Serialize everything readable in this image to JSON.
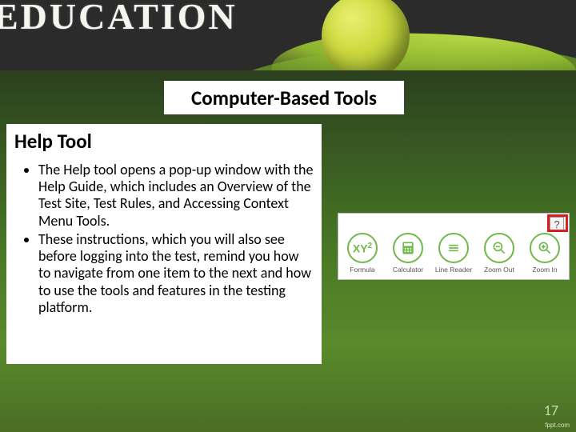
{
  "banner": {
    "chalk_word": "EDUCATION"
  },
  "title": "Computer-Based Tools",
  "subheading": "Help Tool",
  "bullets": [
    "The Help tool opens a pop-up window with the Help Guide, which includes an Overview of the Test Site, Test Rules, and Accessing Context Menu Tools.",
    "These instructions, which you will also see before logging into the test, remind you how to navigate from one item to the next and how to use the tools and features in the testing platform."
  ],
  "toolbar": {
    "help_glyph": "?",
    "tools": [
      {
        "key": "formula",
        "label": "Formula",
        "glyph": "XY²"
      },
      {
        "key": "calculator",
        "label": "Calculator",
        "glyph": "calc"
      },
      {
        "key": "linereader",
        "label": "Line Reader",
        "glyph": "lines"
      },
      {
        "key": "zoomout",
        "label": "Zoom Out",
        "glyph": "minus"
      },
      {
        "key": "zoomin",
        "label": "Zoom In",
        "glyph": "plus"
      }
    ]
  },
  "page_number": "17",
  "footer": "fppt.com"
}
